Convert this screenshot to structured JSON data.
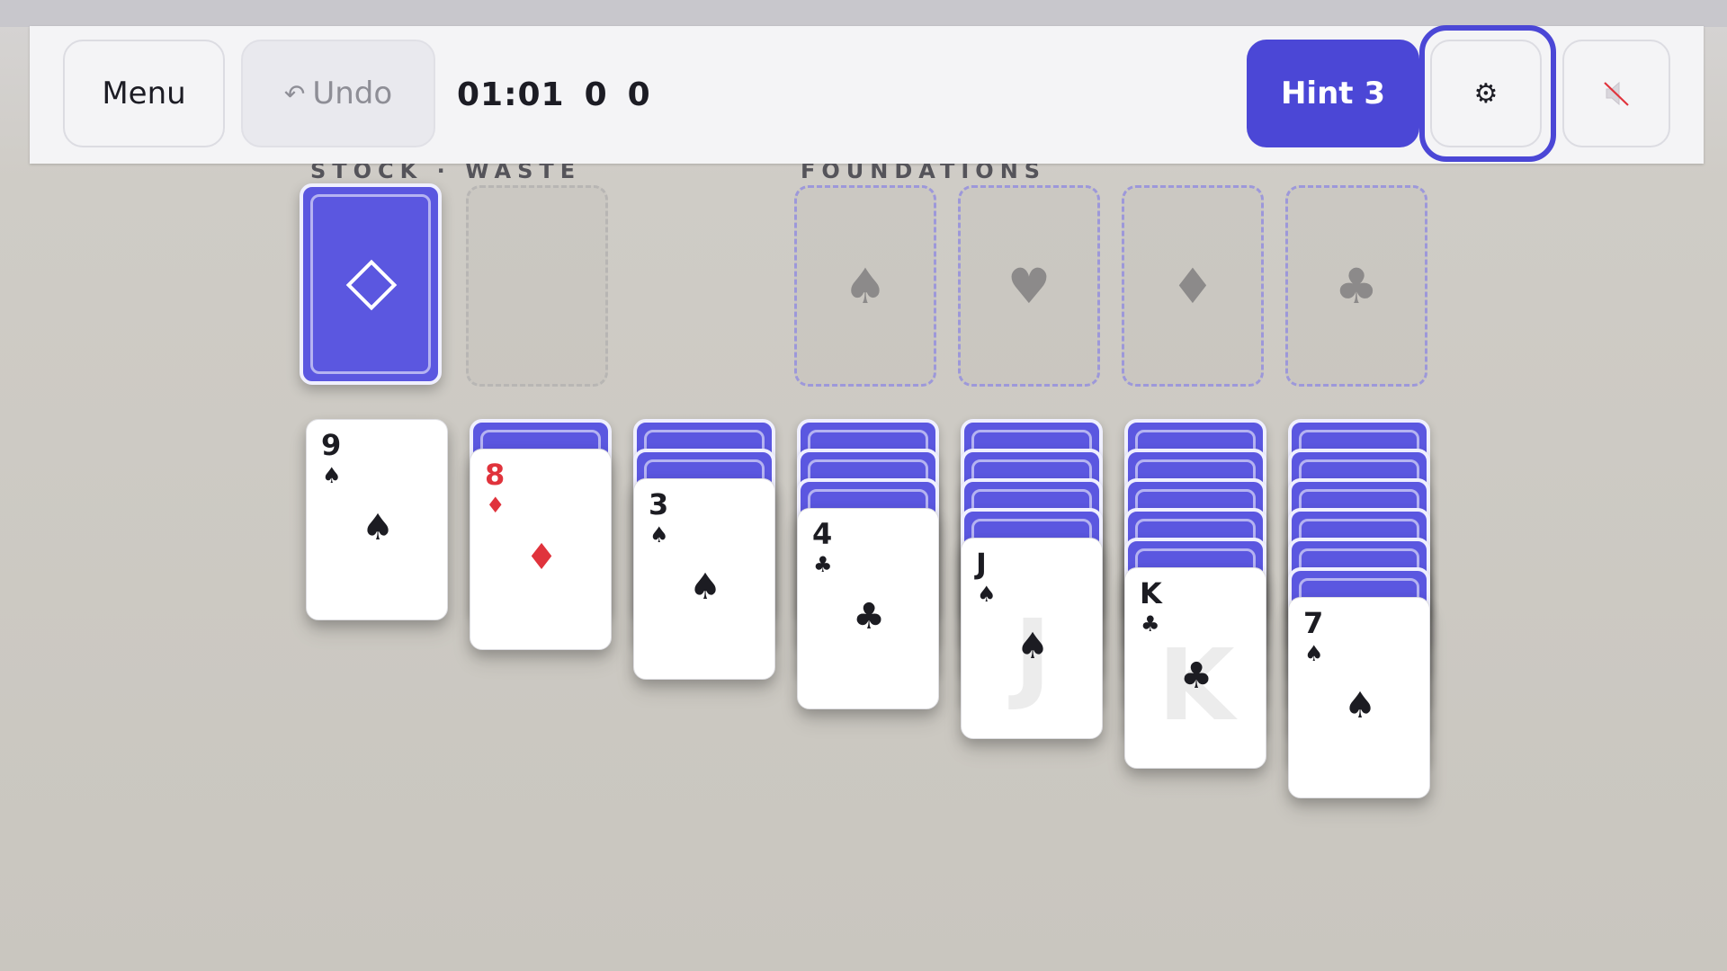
{
  "toolbar": {
    "menu_label": "Menu",
    "undo_icon": "↶",
    "undo_label": "Undo",
    "timer": "01:01",
    "moves": "0",
    "score": "0",
    "hint_label": "Hint 3",
    "settings_icon": "⚙",
    "sound_icon": "muted-speaker-icon"
  },
  "labels": {
    "stock_waste": "STOCK · WASTE",
    "foundations": "FOUNDATIONS"
  },
  "stock": {
    "back_icon": "diamond-outline-icon"
  },
  "foundations": [
    "♠",
    "♥",
    "♦",
    "♣"
  ],
  "tableau": [
    {
      "face_down": 0,
      "rank": "9",
      "suit": "♠",
      "color": "black",
      "watermark": ""
    },
    {
      "face_down": 1,
      "rank": "8",
      "suit": "♦",
      "color": "red",
      "watermark": ""
    },
    {
      "face_down": 2,
      "rank": "3",
      "suit": "♠",
      "color": "black",
      "watermark": ""
    },
    {
      "face_down": 3,
      "rank": "4",
      "suit": "♣",
      "color": "black",
      "watermark": ""
    },
    {
      "face_down": 4,
      "rank": "J",
      "suit": "♠",
      "color": "black",
      "watermark": "J"
    },
    {
      "face_down": 5,
      "rank": "K",
      "suit": "♣",
      "color": "black",
      "watermark": "K"
    },
    {
      "face_down": 6,
      "rank": "7",
      "suit": "♠",
      "color": "black",
      "watermark": ""
    }
  ],
  "colors": {
    "accent": "#4b47d6",
    "card_back": "#5b57e0",
    "red_suit": "#e0333c"
  }
}
